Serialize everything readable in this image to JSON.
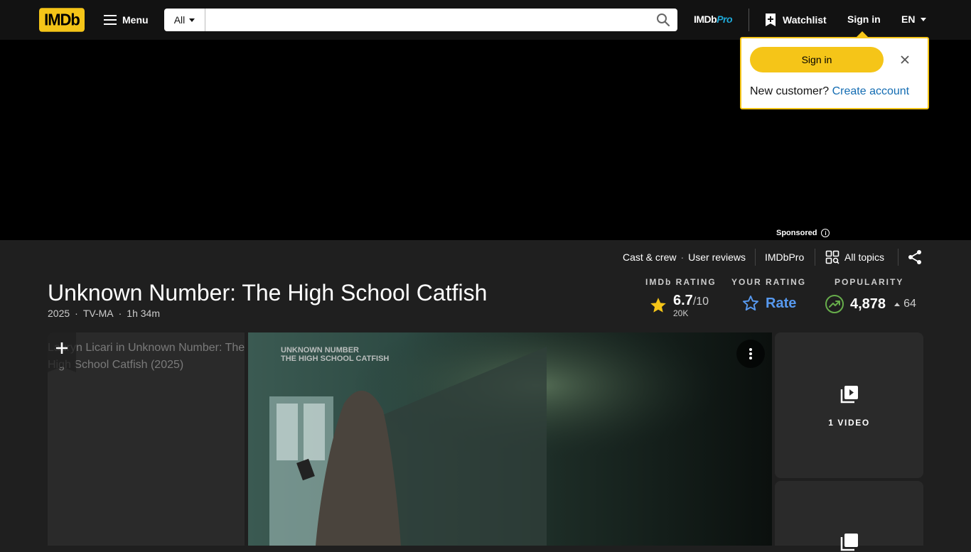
{
  "header": {
    "logo_text": "IMDb",
    "menu_label": "Menu",
    "search_category": "All",
    "search_placeholder": "",
    "imdbpro_prefix": "IMDb",
    "imdbpro_suffix": "Pro",
    "watchlist_label": "Watchlist",
    "signin_label": "Sign in",
    "language": "EN"
  },
  "popup": {
    "signin_label": "Sign in",
    "new_customer": "New customer?",
    "create_account": "Create account"
  },
  "ad": {
    "sponsored_label": "Sponsored"
  },
  "subnav": {
    "cast_crew": "Cast & crew",
    "user_reviews": "User reviews",
    "imdbpro": "IMDbPro",
    "all_topics": "All topics"
  },
  "title": {
    "name": "Unknown Number: The High School Catfish",
    "year": "2025",
    "rating_cert": "TV-MA",
    "runtime": "1h 34m"
  },
  "ratings": {
    "imdb_label": "IMDb RATING",
    "imdb_score": "6.7",
    "imdb_max": "/10",
    "imdb_votes": "20K",
    "your_label": "YOUR RATING",
    "rate_label": "Rate",
    "popularity_label": "POPULARITY",
    "popularity_value": "4,878",
    "popularity_change": "64"
  },
  "media": {
    "poster_alt": "Lauryn Licari in Unknown Number: The High School Catfish (2025)",
    "video_overlay_title_1": "UNKNOWN NUMBER",
    "video_overlay_title_2": "THE HIGH SCHOOL CATFISH",
    "videos_label": "1 VIDEO"
  },
  "colors": {
    "brand_yellow": "#f5c518",
    "link_blue": "#136cb2",
    "rate_blue": "#5799ef",
    "popularity_green": "#67ad4b"
  }
}
